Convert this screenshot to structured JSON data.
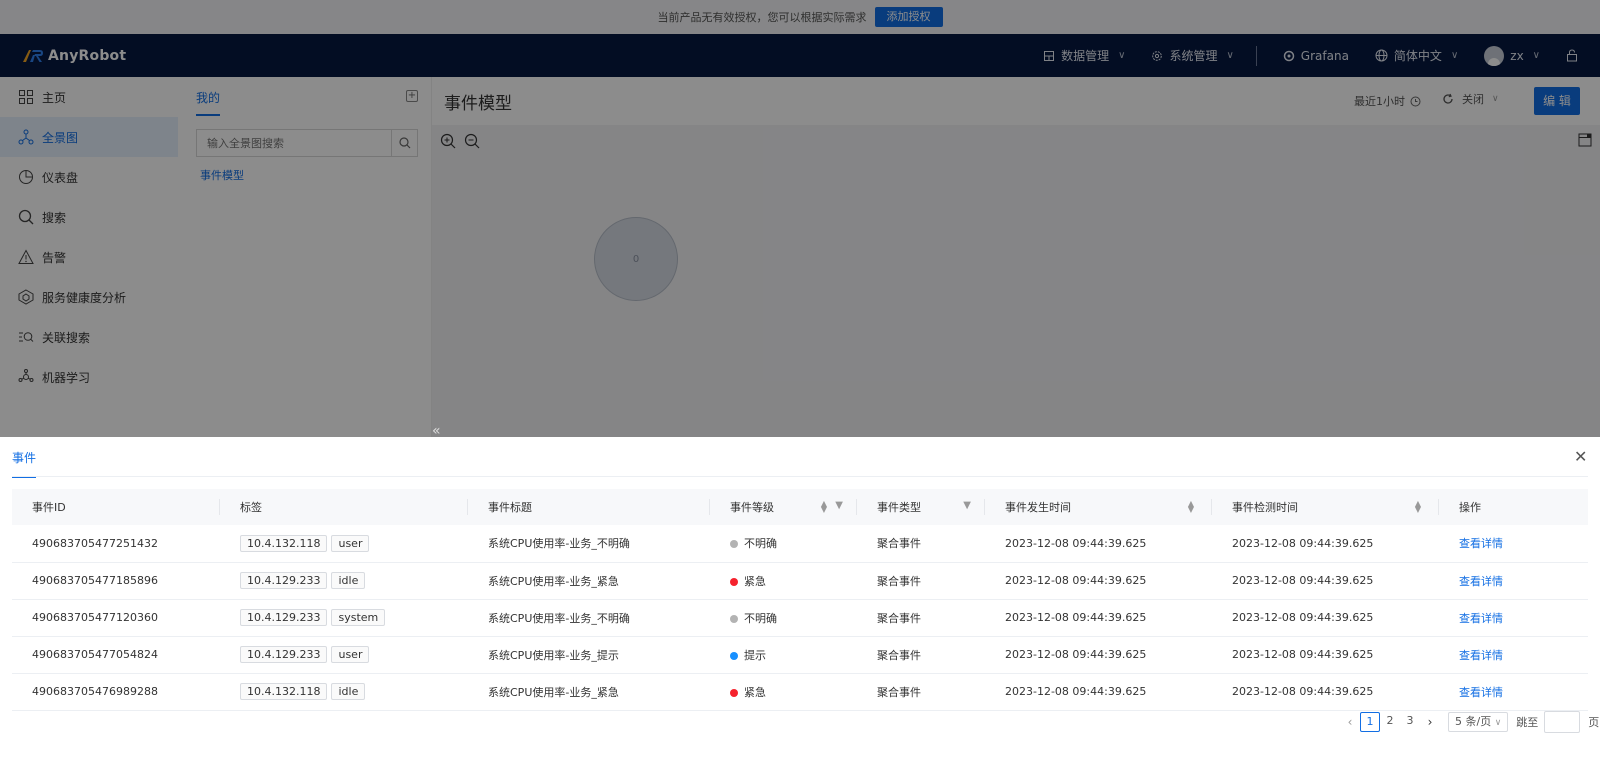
{
  "banner": {
    "message": "当前产品无有效授权，您可以根据实际需求",
    "button": "添加授权"
  },
  "topbar": {
    "logo": "AnyRobot",
    "data_mgmt": "数据管理",
    "sys_mgmt": "系统管理",
    "grafana": "Grafana",
    "language": "简体中文",
    "user": "zx"
  },
  "sidebar": {
    "items": [
      {
        "label": "主页",
        "icon": "home-grid-icon"
      },
      {
        "label": "全景图",
        "icon": "topology-icon"
      },
      {
        "label": "仪表盘",
        "icon": "dashboard-icon"
      },
      {
        "label": "搜索",
        "icon": "search-icon"
      },
      {
        "label": "告警",
        "icon": "alert-icon"
      },
      {
        "label": "服务健康度分析",
        "icon": "service-health-icon"
      },
      {
        "label": "关联搜索",
        "icon": "related-search-icon"
      },
      {
        "label": "机器学习",
        "icon": "ml-icon"
      }
    ]
  },
  "tree": {
    "tab": "我的",
    "search_placeholder": "输入全景图搜索",
    "node": "事件模型"
  },
  "main": {
    "title": "事件模型",
    "time_range": "最近1小时",
    "refresh": "关闭",
    "edit": "编 辑",
    "node_value": "0"
  },
  "drawer": {
    "tab": "事件",
    "columns": [
      "事件ID",
      "标签",
      "事件标题",
      "事件等级",
      "事件类型",
      "事件发生时间",
      "事件检测时间",
      "操作"
    ],
    "rows": [
      {
        "id": "490683705477251432",
        "tags": [
          "10.4.132.118",
          "user"
        ],
        "title": "系统CPU使用率-业务_不明确",
        "level": "不明确",
        "level_color": "#b3b3b3",
        "type": "聚合事件",
        "occur": "2023-12-08 09:44:39.625",
        "detect": "2023-12-08 09:44:39.625",
        "action": "查看详情"
      },
      {
        "id": "490683705477185896",
        "tags": [
          "10.4.129.233",
          "idle"
        ],
        "title": "系统CPU使用率-业务_紧急",
        "level": "紧急",
        "level_color": "#f5222d",
        "type": "聚合事件",
        "occur": "2023-12-08 09:44:39.625",
        "detect": "2023-12-08 09:44:39.625",
        "action": "查看详情"
      },
      {
        "id": "490683705477120360",
        "tags": [
          "10.4.129.233",
          "system"
        ],
        "title": "系统CPU使用率-业务_不明确",
        "level": "不明确",
        "level_color": "#b3b3b3",
        "type": "聚合事件",
        "occur": "2023-12-08 09:44:39.625",
        "detect": "2023-12-08 09:44:39.625",
        "action": "查看详情"
      },
      {
        "id": "490683705477054824",
        "tags": [
          "10.4.129.233",
          "user"
        ],
        "title": "系统CPU使用率-业务_提示",
        "level": "提示",
        "level_color": "#1890ff",
        "type": "聚合事件",
        "occur": "2023-12-08 09:44:39.625",
        "detect": "2023-12-08 09:44:39.625",
        "action": "查看详情"
      },
      {
        "id": "490683705476989288",
        "tags": [
          "10.4.132.118",
          "idle"
        ],
        "title": "系统CPU使用率-业务_紧急",
        "level": "紧急",
        "level_color": "#f5222d",
        "type": "聚合事件",
        "occur": "2023-12-08 09:44:39.625",
        "detect": "2023-12-08 09:44:39.625",
        "action": "查看详情"
      }
    ],
    "pager": {
      "pages": [
        "1",
        "2",
        "3"
      ],
      "current": "1",
      "page_size": "5 条/页",
      "jump_label": "跳至",
      "page_unit": "页"
    }
  },
  "colors": {
    "accent": "#126ee3",
    "nav_bg": "#061841"
  }
}
